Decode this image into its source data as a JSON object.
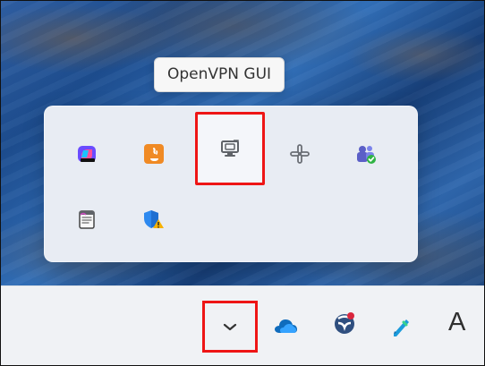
{
  "tooltip": {
    "text": "OpenVPN GUI"
  },
  "overflow_flyout": {
    "icons": [
      {
        "name": "copilot-icon",
        "accent": "#ff4f9a"
      },
      {
        "name": "java-update-icon",
        "accent": "#f08a24"
      },
      {
        "name": "openvpn-gui-icon",
        "accent": "#5f6368"
      },
      {
        "name": "slack-icon",
        "accent": "#6b6f76"
      },
      {
        "name": "teams-icon",
        "accent": "#5b5fc7"
      },
      {
        "name": "notepad-icon",
        "accent": "#d44ac4"
      },
      {
        "name": "windows-security-warning-icon",
        "accent": "#f6b100"
      }
    ]
  },
  "taskbar": {
    "keyboard_layout_label": "A",
    "icons": [
      "chevron-up-icon",
      "onedrive-icon",
      "security-icon",
      "pen-icon"
    ]
  },
  "highlights": {
    "selection_color": "#ee1515"
  }
}
